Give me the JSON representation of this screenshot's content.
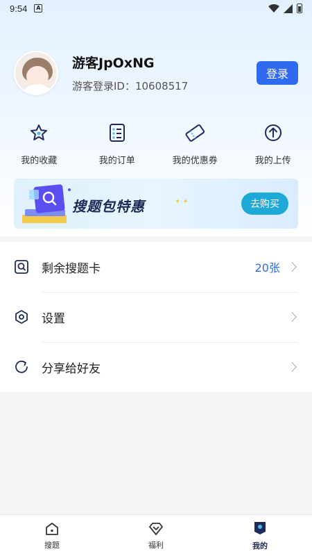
{
  "status_bar": {
    "time": "9:54",
    "notification_letter": "A"
  },
  "profile": {
    "nickname": "游客JpOxNG",
    "guest_id": "游客登录ID：10608517",
    "login_label": "登录"
  },
  "quick_actions": [
    {
      "label": "我的收藏",
      "icon": "star-icon"
    },
    {
      "label": "我的订单",
      "icon": "order-list-icon"
    },
    {
      "label": "我的优惠券",
      "icon": "coupon-icon"
    },
    {
      "label": "我的上传",
      "icon": "upload-icon"
    }
  ],
  "banner": {
    "title": "搜题包特惠",
    "button_label": "去购买"
  },
  "menu": [
    {
      "label": "剩余搜题卡",
      "value": "20张",
      "icon": "search-card-icon"
    },
    {
      "label": "设置",
      "icon": "settings-icon"
    },
    {
      "label": "分享给好友",
      "icon": "share-icon"
    }
  ],
  "tabs": [
    {
      "label": "搜题",
      "icon": "home-icon"
    },
    {
      "label": "福利",
      "icon": "gift-icon"
    },
    {
      "label": "我的",
      "icon": "profile-icon",
      "active": true
    }
  ],
  "colors": {
    "accent": "#2f6bf0",
    "banner_button": "#1fa9d6",
    "active_tab": "#1f2a5a"
  }
}
